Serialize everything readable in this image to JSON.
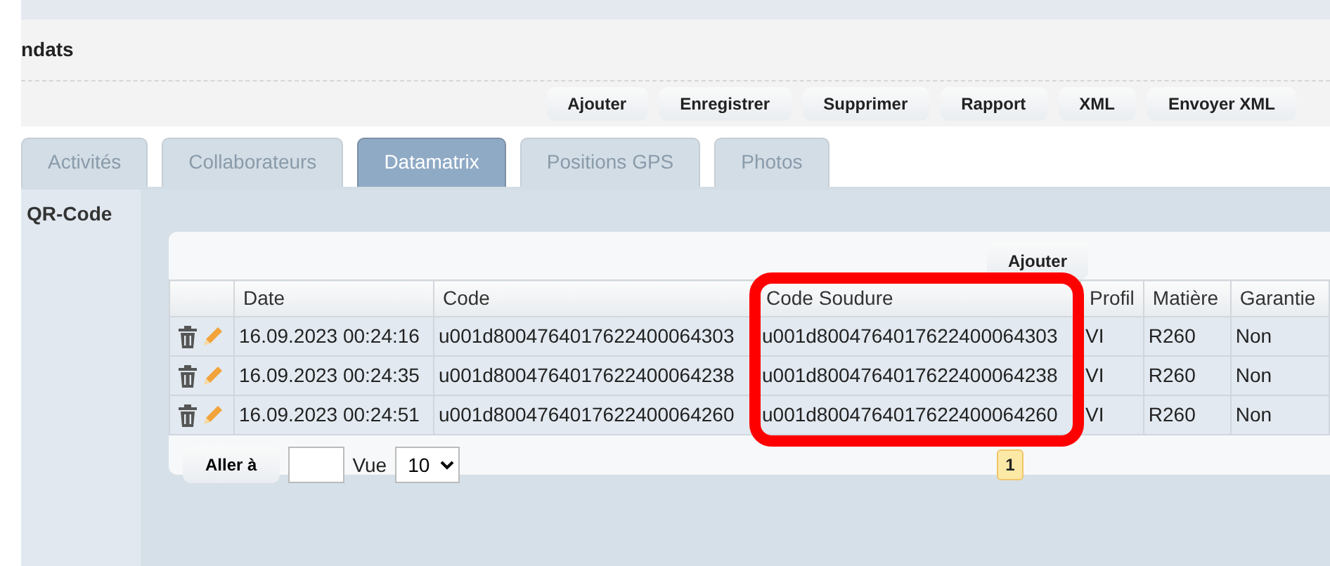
{
  "header": {
    "title": "ndats"
  },
  "toolbar": [
    "Ajouter",
    "Enregistrer",
    "Supprimer",
    "Rapport",
    "XML",
    "Envoyer XML"
  ],
  "tabs": [
    {
      "label": "Activités",
      "selected": false
    },
    {
      "label": "Collaborateurs",
      "selected": false
    },
    {
      "label": "Datamatrix",
      "selected": true
    },
    {
      "label": "Positions GPS",
      "selected": false
    },
    {
      "label": "Photos",
      "selected": false
    }
  ],
  "section": {
    "label": "QR-Code"
  },
  "grid": {
    "add_button": "Ajouter",
    "columns": [
      {
        "label": "Date",
        "highlighted": false
      },
      {
        "label": "Code",
        "highlighted": false
      },
      {
        "label": "Code Soudure",
        "highlighted": true
      },
      {
        "label": "Profil",
        "highlighted": false
      },
      {
        "label": "Matière",
        "highlighted": false
      },
      {
        "label": "Garantie",
        "highlighted": false
      }
    ],
    "rows": [
      [
        "16.09.2023 00:24:16",
        "u001d8004764017622400064303",
        "u001d8004764017622400064303",
        "VI",
        "R260",
        "Non"
      ],
      [
        "16.09.2023 00:24:35",
        "u001d8004764017622400064238",
        "u001d8004764017622400064238",
        "VI",
        "R260",
        "Non"
      ],
      [
        "16.09.2023 00:24:51",
        "u001d8004764017622400064260",
        "u001d8004764017622400064260",
        "VI",
        "R260",
        "Non"
      ]
    ],
    "pager": {
      "goto_button": "Aller à",
      "view_label": "Vue",
      "page_size": "10",
      "pages": [
        {
          "label": "1",
          "selected": true
        }
      ]
    }
  }
}
